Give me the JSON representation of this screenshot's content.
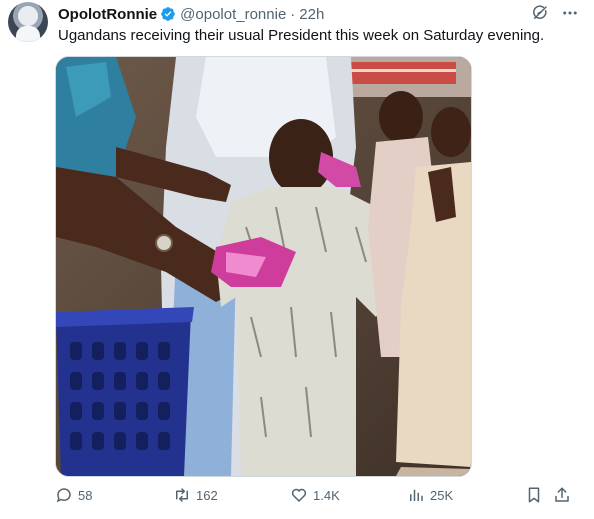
{
  "tweet": {
    "author_name": "OpolotRonnie",
    "handle": "@opolot_ronnie",
    "separator": "·",
    "time": "22h",
    "text": "Ugandans receiving their usual President this week on Saturday evening."
  },
  "icons": {
    "verified": "verified-badge-icon",
    "grok": "grok-slash-icon",
    "more": "more-horizontal-icon",
    "reply": "reply-icon",
    "repost": "repost-icon",
    "like": "heart-icon",
    "views": "views-bar-icon",
    "bookmark": "bookmark-icon",
    "share": "share-icon"
  },
  "metrics": {
    "replies": "58",
    "reposts": "162",
    "likes": "1.4K",
    "views": "25K"
  },
  "colors": {
    "text_primary": "#0f1419",
    "text_secondary": "#536471",
    "verified_blue": "#1d9bf0",
    "border": "#cfd9de"
  }
}
